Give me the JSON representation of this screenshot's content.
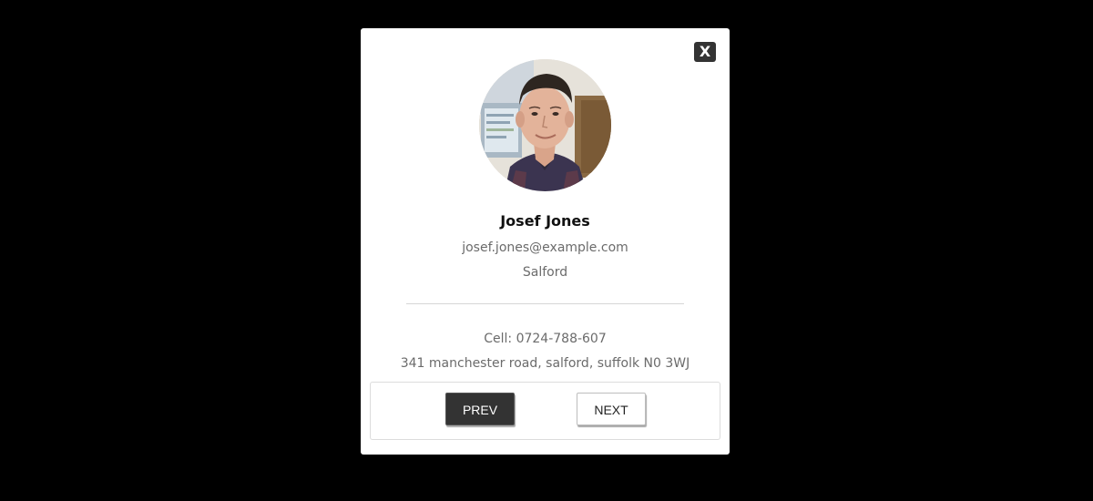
{
  "modal": {
    "close_label": "X",
    "avatar": {
      "icon": "profile-photo",
      "alt": ""
    },
    "name": "Josef Jones",
    "email": "josef.jones@example.com",
    "city": "Salford",
    "cell": "Cell: 0724-788-607",
    "address": "341 manchester road, salford, suffolk N0 3WJ",
    "buttons": {
      "prev_label": "PREV",
      "next_label": "NEXT"
    }
  },
  "colors": {
    "backdrop": "#000000",
    "modal_bg": "#ffffff",
    "dark_button": "#333333",
    "muted_text": "#6b6b6b"
  }
}
